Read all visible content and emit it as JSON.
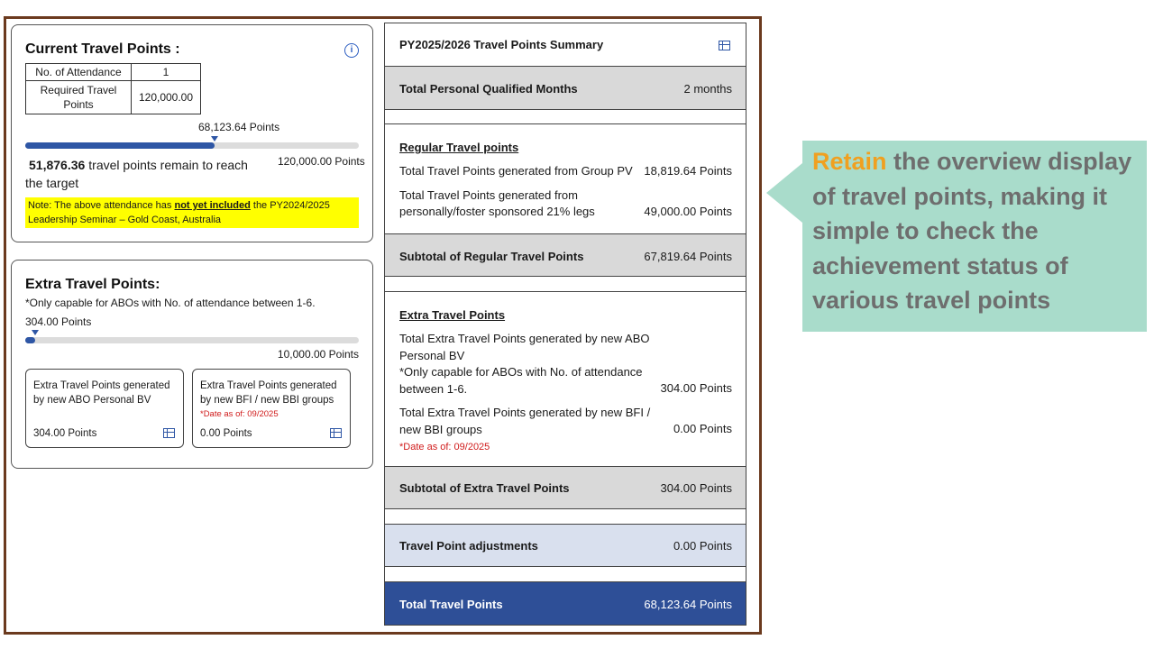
{
  "current": {
    "title": "Current Travel Points :",
    "table": {
      "attendance_label": "No. of Attendance",
      "attendance_value": "1",
      "required_label": "Required Travel Points",
      "required_value": "120,000.00"
    },
    "current_points_label": "68,123.64 Points",
    "progress_fraction": 0.5677,
    "remain_value": "51,876.36",
    "remain_text": "travel points remain to reach the target",
    "target_label": "120,000.00 Points",
    "note": {
      "prefix": "Note: The above attendance has ",
      "emphasis": "not yet included",
      "suffix": " the PY2024/2025 Leadership Seminar – Gold Coast, Australia"
    }
  },
  "extra": {
    "title": "Extra Travel Points:",
    "subtitle": "*Only capable for ABOs with No. of attendance between 1-6.",
    "current_label": "304.00 Points",
    "progress_fraction": 0.0304,
    "target_label": "10,000.00 Points",
    "box1": {
      "label": "Extra Travel Points generated by new ABO Personal BV",
      "value": "304.00 Points"
    },
    "box2": {
      "label": "Extra Travel Points generated by new BFI / new BBI groups",
      "date": "*Date as of: 09/2025",
      "value": "0.00 Points"
    }
  },
  "summary": {
    "title": "PY2025/2026 Travel Points Summary",
    "qualified": {
      "label": "Total Personal Qualified Months",
      "value": "2 months"
    },
    "regular": {
      "title": "Regular Travel points",
      "row1": {
        "label": "Total Travel Points generated from Group PV",
        "value": "18,819.64 Points"
      },
      "row2": {
        "label": "Total Travel Points generated from personally/foster sponsored 21% legs",
        "value": "49,000.00 Points"
      },
      "subtotal": {
        "label": "Subtotal of Regular Travel Points",
        "value": "67,819.64 Points"
      }
    },
    "extra": {
      "title": "Extra Travel Points",
      "row1": {
        "label": "Total Extra Travel Points generated by new ABO Personal BV",
        "note": "*Only capable for ABOs with No. of attendance between 1-6.",
        "value": "304.00 Points"
      },
      "row2": {
        "label": "Total Extra Travel Points generated by new BFI / new BBI groups",
        "date": "*Date as of: 09/2025",
        "value": "0.00 Points"
      },
      "subtotal": {
        "label": "Subtotal of Extra Travel Points",
        "value": "304.00 Points"
      }
    },
    "adjust": {
      "label": "Travel Point adjustments",
      "value": "0.00 Points"
    },
    "total": {
      "label": "Total Travel Points",
      "value": "68,123.64 Points"
    }
  },
  "callout": {
    "highlight": "Retain",
    "text": " the overview display of travel points, making it simple to check the achievement status of various travel points"
  },
  "colors": {
    "frame": "#6b3a1e",
    "progress": "#2e56a5",
    "note_bg": "#ffff00",
    "total_bg": "#2e4f97",
    "callout_bg": "#a9dccb",
    "callout_highlight": "#f0a020"
  }
}
